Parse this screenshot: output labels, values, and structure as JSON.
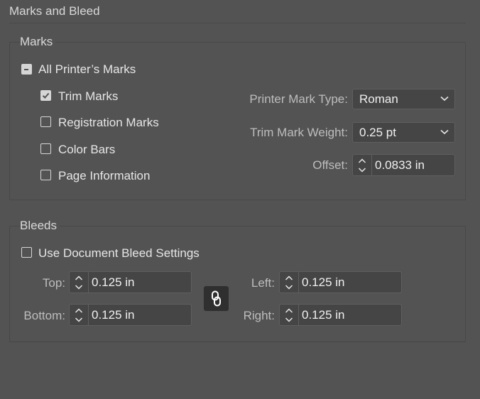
{
  "section_title": "Marks and Bleed",
  "marks": {
    "group_label": "Marks",
    "all_printers_marks": {
      "label": "All Printer’s Marks",
      "state": "mixed"
    },
    "trim_marks": {
      "label": "Trim Marks",
      "checked": true
    },
    "registration_marks": {
      "label": "Registration Marks",
      "checked": false
    },
    "color_bars": {
      "label": "Color Bars",
      "checked": false
    },
    "page_information": {
      "label": "Page Information",
      "checked": false
    },
    "printer_mark_type": {
      "label": "Printer Mark Type:",
      "value": "Roman"
    },
    "trim_mark_weight": {
      "label": "Trim Mark Weight:",
      "value": "0.25 pt"
    },
    "offset": {
      "label": "Offset:",
      "value": "0.0833 in"
    }
  },
  "bleeds": {
    "group_label": "Bleeds",
    "use_document_bleed": {
      "label": "Use Document Bleed Settings",
      "checked": false
    },
    "top": {
      "label": "Top:",
      "value": "0.125 in"
    },
    "bottom": {
      "label": "Bottom:",
      "value": "0.125 in"
    },
    "left": {
      "label": "Left:",
      "value": "0.125 in"
    },
    "right": {
      "label": "Right:",
      "value": "0.125 in"
    }
  },
  "icons": {
    "link": "link-icon",
    "chevron": "chevron-down-icon",
    "stepper": "stepper-icon",
    "check": "checkmark-icon"
  },
  "colors": {
    "background": "#535353",
    "field": "#454545",
    "link_button": "#2f2f2f"
  }
}
